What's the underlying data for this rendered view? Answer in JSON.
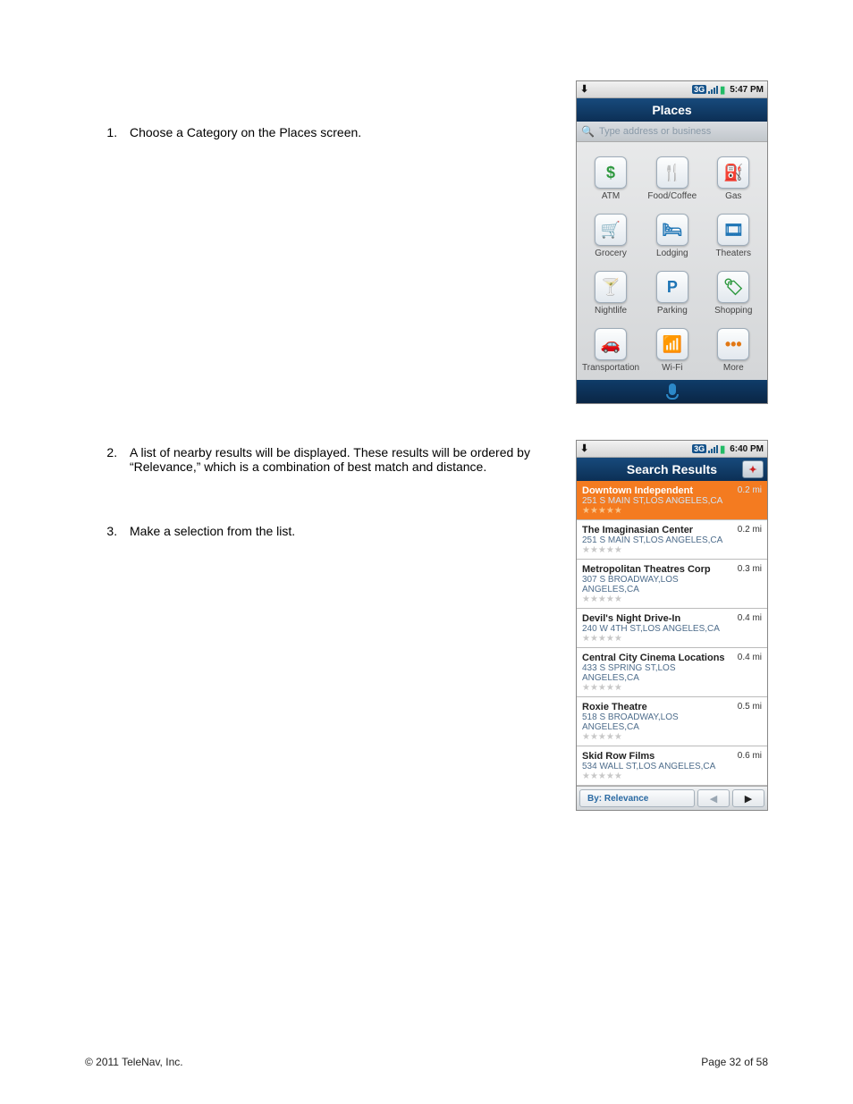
{
  "steps": {
    "s1": "Choose a Category on the Places screen.",
    "s2": "A list of nearby results will be displayed. These results will be ordered by “Relevance,” which is a combination of best match and distance.",
    "s3": "Make a selection from the list."
  },
  "phone": {
    "places": {
      "time": "5:47 PM",
      "tg": "3G",
      "title": "Places",
      "search_ph": "Type address or business",
      "cats": {
        "atm": "ATM",
        "food": "Food/Coffee",
        "gas": "Gas",
        "grocery": "Grocery",
        "lodging": "Lodging",
        "theaters": "Theaters",
        "nightlife": "Nightlife",
        "parking": "Parking",
        "shopping": "Shopping",
        "transport": "Transportation",
        "wifi": "Wi-Fi",
        "more": "More"
      }
    },
    "results": {
      "time": "6:40 PM",
      "tg": "3G",
      "title": "Search Results",
      "sort_label": "By:  Relevance",
      "items": {
        "r0": {
          "name": "Downtown Independent",
          "addr": "251 S MAIN ST,LOS ANGELES,CA",
          "stars": "★★★★★",
          "dist": "0.2 mi"
        },
        "r1": {
          "name": "The Imaginasian Center",
          "addr": "251 S MAIN ST,LOS ANGELES,CA",
          "stars": "★★★★★",
          "dist": "0.2 mi"
        },
        "r2": {
          "name": "Metropolitan Theatres Corp",
          "addr": "307 S BROADWAY,LOS ANGELES,CA",
          "stars": "★★★★★",
          "dist": "0.3 mi"
        },
        "r3": {
          "name": "Devil's Night Drive-In",
          "addr": "240 W 4TH ST,LOS ANGELES,CA",
          "stars": "★★★★★",
          "dist": "0.4 mi"
        },
        "r4": {
          "name": "Central City Cinema Locations",
          "addr": "433 S SPRING ST,LOS ANGELES,CA",
          "stars": "★★★★★",
          "dist": "0.4 mi"
        },
        "r5": {
          "name": "Roxie Theatre",
          "addr": "518 S BROADWAY,LOS ANGELES,CA",
          "stars": "★★★★★",
          "dist": "0.5 mi"
        },
        "r6": {
          "name": "Skid Row Films",
          "addr": "534 WALL ST,LOS ANGELES,CA",
          "stars": "★★★★★",
          "dist": "0.6 mi"
        }
      }
    }
  },
  "footer": {
    "copyright": "© 2011 TeleNav, Inc.",
    "page": "Page 32 of 58"
  }
}
